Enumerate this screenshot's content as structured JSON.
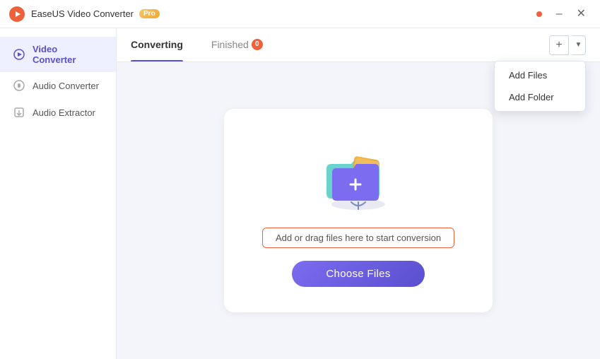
{
  "app": {
    "title": "EaseUS Video Converter",
    "pro_badge": "Pro"
  },
  "tabs": {
    "converting_label": "Converting",
    "finished_label": "Finished",
    "finished_badge": "0"
  },
  "dropdown": {
    "add_files_label": "Add Files",
    "add_folder_label": "Add Folder"
  },
  "sidebar": {
    "items": [
      {
        "label": "Video Converter",
        "icon": "video-icon",
        "active": true
      },
      {
        "label": "Audio Converter",
        "icon": "audio-icon",
        "active": false
      },
      {
        "label": "Audio Extractor",
        "icon": "extractor-icon",
        "active": false
      }
    ]
  },
  "dropzone": {
    "drag_text": "Add or drag files here to start conversion",
    "choose_label": "Choose Files"
  }
}
